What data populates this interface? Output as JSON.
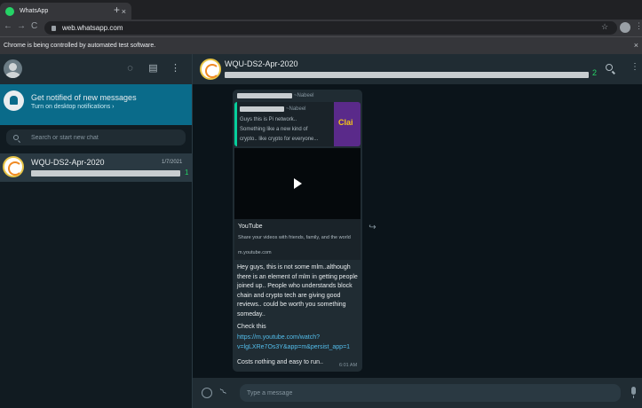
{
  "browser": {
    "tab_title": "WhatsApp",
    "tab_close": "×",
    "new_tab": "+",
    "back": "←",
    "forward": "→",
    "reload": "C",
    "url": "web.whatsapp.com",
    "star": "☆",
    "menu": "⋮",
    "automation_notice": "Chrome is being controlled by automated test software.",
    "notice_close": "×"
  },
  "sidebar": {
    "header_icons": {
      "status": "◌",
      "new_chat": "▤",
      "menu": "⋮"
    },
    "notification": {
      "title": "Get notified of new messages",
      "subtitle": "Turn on desktop notifications ›"
    },
    "search": {
      "placeholder": "Search or start new chat"
    },
    "chats": [
      {
        "name": "WQU-DS2-Apr-2020",
        "date": "1/7/2021",
        "unread": "1"
      }
    ]
  },
  "conversation": {
    "title": "WQU-DS2-Apr-2020",
    "badge": "2",
    "menu": "⋮",
    "message": {
      "sender_suffix": "~Nabeel",
      "quoted": {
        "sender_suffix": "~Nabeel",
        "lines": [
          "Guys this is Pi network..",
          "Something like a new kind of",
          "crypto.. like crypto for everyone..."
        ],
        "thumb_text": "Clai"
      },
      "link_preview": {
        "title": "YouTube",
        "description": "Share your videos with friends, family, and the world",
        "domain": "m.youtube.com"
      },
      "body": "Hey guys, this is not some mlm..although there is an element of mlm in getting people joined up.. People who understands block chain and crypto tech are giving good reviews.. could be worth you something someday..",
      "check_this": "Check this",
      "link": "https://m.youtube.com/watch?v=lgLXRe7Os3Y&app=m&persist_app=1",
      "closing": "Costs nothing and easy to run..",
      "time": "6:01 AM"
    },
    "forward_icon": "↪",
    "composer": {
      "placeholder": "Type a message"
    }
  }
}
